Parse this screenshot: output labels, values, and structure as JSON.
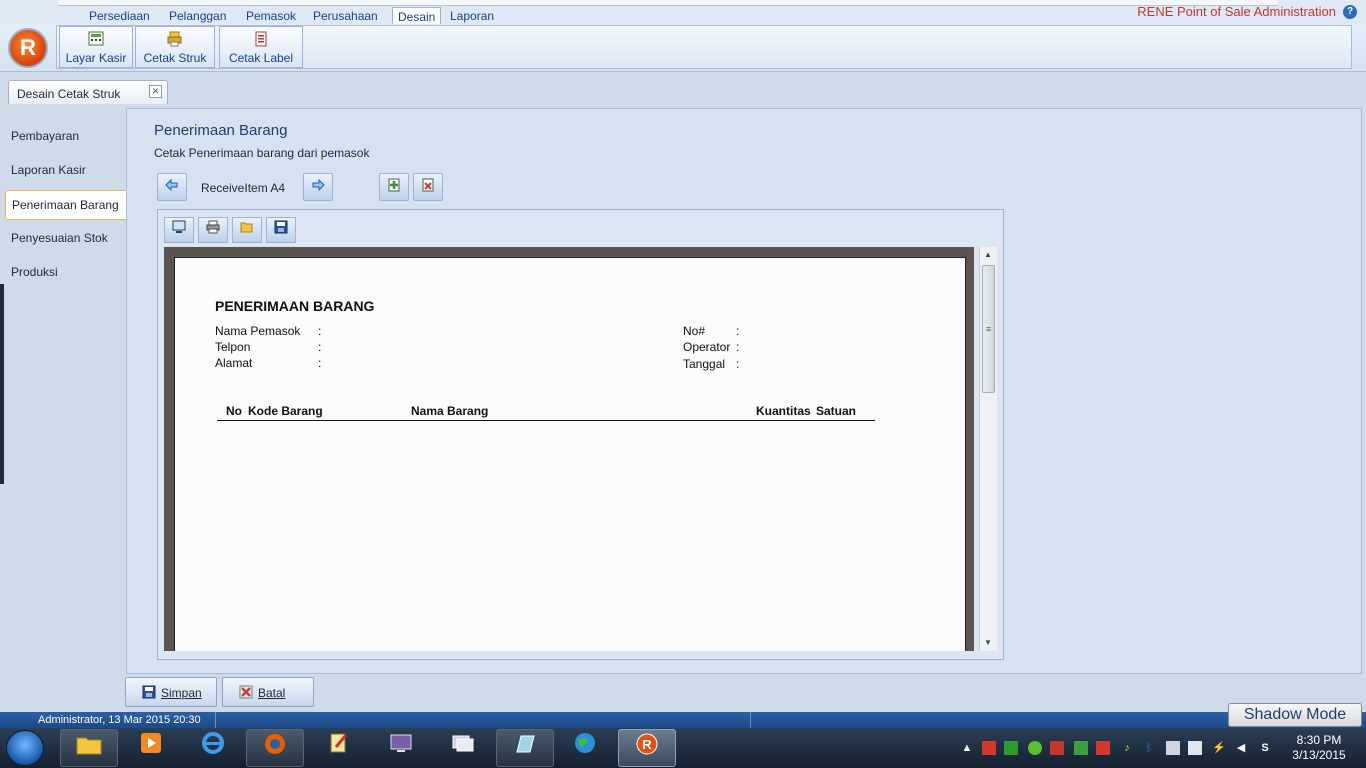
{
  "app": {
    "title": "RENE Point of Sale Administration",
    "help": "?",
    "orb_letter": "R"
  },
  "menu_tabs": [
    "Persediaan",
    "Pelanggan",
    "Pemasok",
    "Perusahaan",
    "Desain",
    "Laporan"
  ],
  "active_menu_tab": "Desain",
  "ribbon": {
    "buttons": [
      {
        "label": "Layar Kasir",
        "icon": "cashier-screen-icon"
      },
      {
        "label": "Cetak Struk",
        "icon": "print-receipt-icon"
      },
      {
        "label": "Cetak Label",
        "icon": "print-label-icon"
      }
    ]
  },
  "doc_tab": {
    "label": "Desain Cetak Struk",
    "close": "✕"
  },
  "nav": {
    "items": [
      "Pembayaran",
      "Laporan Kasir",
      "Penerimaan Barang",
      "Penyesuaian Stok",
      "Produksi"
    ],
    "active": "Penerimaan Barang"
  },
  "page": {
    "title": "Penerimaan Barang",
    "subtitle": "Cetak Penerimaan barang dari pemasok",
    "template_name": "ReceiveItem A4"
  },
  "report": {
    "title": "PENERIMAAN BARANG",
    "left_fields": [
      "Nama Pemasok",
      "Telpon",
      "Alamat"
    ],
    "right_fields": [
      "No#",
      "Operator",
      "Tanggal"
    ],
    "colon": ":",
    "columns": [
      "No",
      "Kode Barang",
      "Nama Barang",
      "Kuantitas",
      "Satuan"
    ]
  },
  "footer": {
    "save_label": "Simpan",
    "cancel_label": "Batal"
  },
  "status": {
    "text": "Administrator, 13 Mar 2015  20:30",
    "shadow_mode": "Shadow Mode"
  },
  "taskbar": {
    "time": "8:30 PM",
    "date": "3/13/2015"
  },
  "colors": {
    "accent": "#15428b",
    "title_red": "#c0392b",
    "status_bar": "#2d5fa2"
  }
}
